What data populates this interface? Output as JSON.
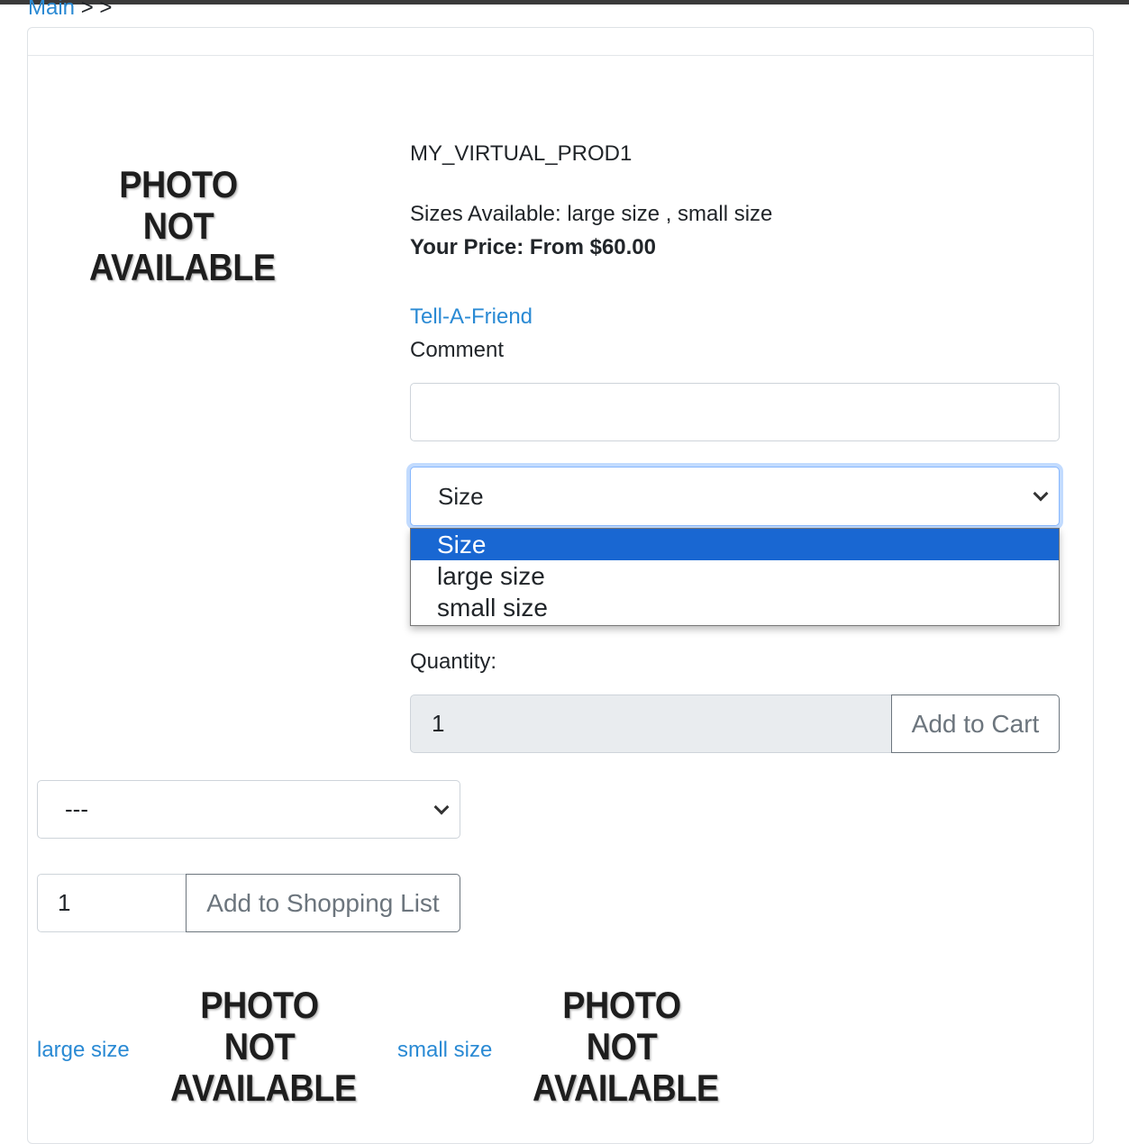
{
  "breadcrumb": {
    "main_link": "Main",
    "sep1": ">",
    "sep2": ">"
  },
  "photo_placeholder": {
    "line1": "PHOTO",
    "line2": "NOT",
    "line3": "AVAILABLE"
  },
  "product": {
    "name": "MY_VIRTUAL_PROD1",
    "sizes_available": "Sizes Available: large size , small size",
    "price": "Your Price: From $60.00",
    "tell_a_friend": "Tell-A-Friend",
    "comment_label": "Comment",
    "comment_value": ""
  },
  "size_select": {
    "selected": "Size",
    "options": [
      "Size",
      "large size",
      "small size"
    ]
  },
  "quantity": {
    "label": "Quantity:",
    "value": "1",
    "add_to_cart": "Add to Cart"
  },
  "shopping_list": {
    "selected": "---",
    "qty_value": "1",
    "add_button": "Add to Shopping List"
  },
  "variants": [
    {
      "label": "large size"
    },
    {
      "label": "small size"
    }
  ],
  "colors": {
    "link": "#2a8ad4",
    "option_selected": "#1967d2"
  }
}
